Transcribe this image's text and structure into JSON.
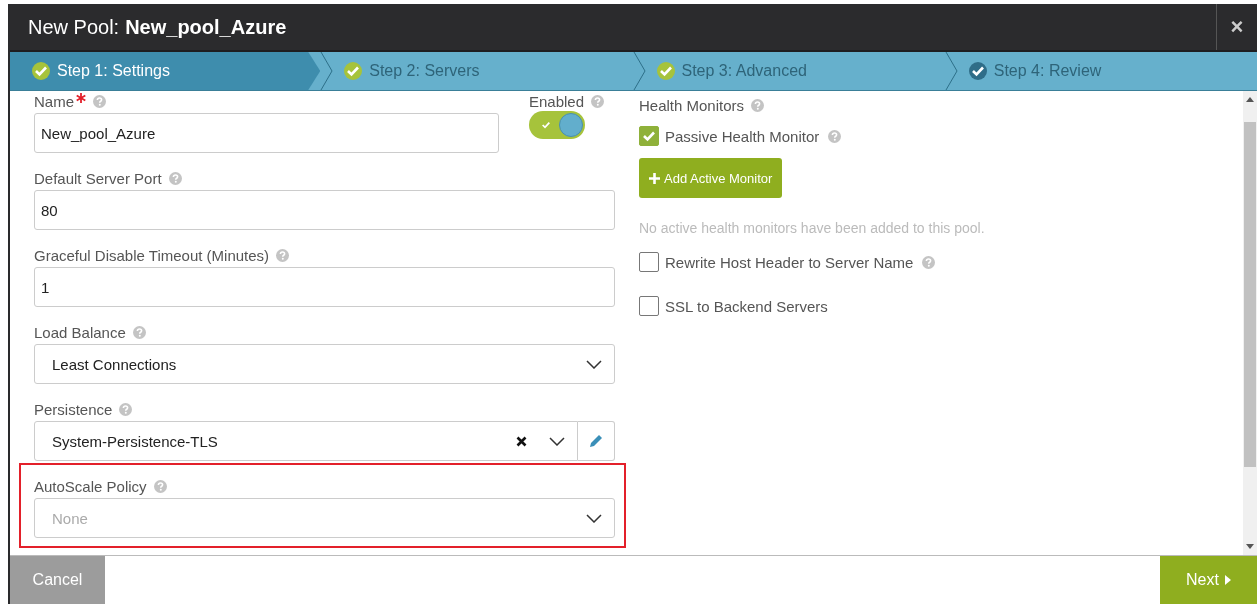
{
  "window": {
    "title_prefix": "New Pool:",
    "title_name": "New_pool_Azure",
    "close": "×"
  },
  "steps": [
    {
      "label": "Step 1: Settings",
      "selected": true,
      "done": true
    },
    {
      "label": "Step 2: Servers",
      "selected": false,
      "done": true
    },
    {
      "label": "Step 3: Advanced",
      "selected": false,
      "done": true
    },
    {
      "label": "Step 4: Review",
      "selected": false,
      "done": false
    }
  ],
  "enabled": {
    "label": "Enabled",
    "on": true
  },
  "fields": [
    {
      "kind": "text",
      "label": "Name",
      "required": true,
      "value": "New_pool_Azure"
    },
    {
      "kind": "text",
      "label": "Default Server Port",
      "required": false,
      "value": "80"
    },
    {
      "kind": "text",
      "label": "Graceful Disable Timeout (Minutes)",
      "required": false,
      "value": "1"
    },
    {
      "kind": "select",
      "label": "Load Balance",
      "required": false,
      "value": "Least Connections"
    },
    {
      "kind": "select",
      "label": "Persistence",
      "required": false,
      "value": "System-Persistence-TLS",
      "clearable": true,
      "editable": true
    },
    {
      "kind": "select",
      "label": "AutoScale Policy",
      "required": false,
      "placeholder": "None",
      "highlighted": true
    }
  ],
  "health_monitors": {
    "label": "Health Monitors",
    "passive": {
      "label": "Passive Health Monitor",
      "checked": true
    },
    "add_button": "Add Active Monitor",
    "empty_note": "No active health monitors have been added to this pool."
  },
  "options": [
    {
      "label": "Rewrite Host Header to Server Name",
      "checked": false,
      "help": true
    },
    {
      "label": "SSL to Backend Servers",
      "checked": false,
      "help": false
    }
  ],
  "footer": {
    "cancel": "Cancel",
    "next": "Next"
  }
}
